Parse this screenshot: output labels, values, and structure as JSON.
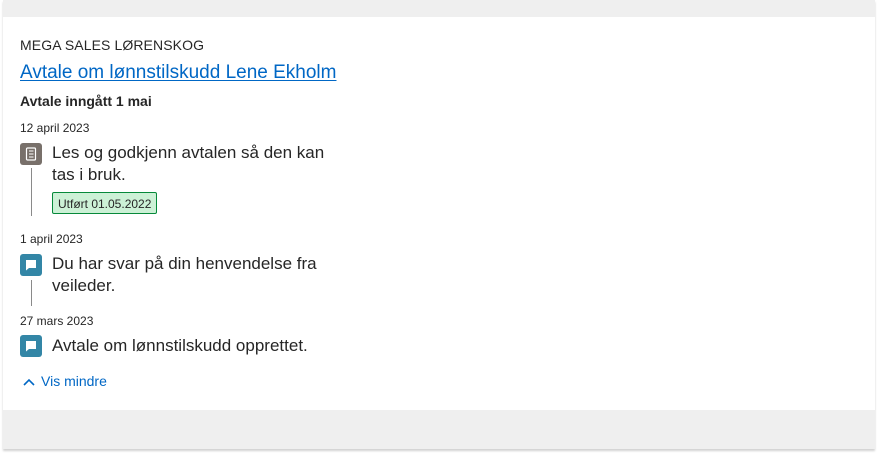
{
  "header": {
    "organization": "MEGA SALES LØRENSKOG",
    "title_link": "Avtale om lønnstilskudd Lene Ekholm",
    "subtitle": "Avtale inngått 1 mai"
  },
  "events": [
    {
      "date": "12 april 2023",
      "icon": "task-list-icon",
      "text": "Les og godkjenn avtalen så den kan tas i bruk.",
      "status_badge": "Utført 01.05.2022"
    },
    {
      "date": "1 april 2023",
      "icon": "speech-bubble-icon",
      "text": "Du har svar på din henvendelse fra veileder."
    },
    {
      "date": "27 mars 2023",
      "icon": "speech-bubble-icon",
      "text": "Avtale om lønnstilskudd opprettet."
    }
  ],
  "toggle": {
    "label": "Vis mindre",
    "icon": "chevron-up-icon"
  },
  "colors": {
    "link": "#0067c5",
    "task_icon_bg": "#78706a",
    "message_icon_bg": "#3386a6",
    "badge_border": "#06893a",
    "badge_bg": "#ccf1d6",
    "frame_bg": "#efefef"
  }
}
